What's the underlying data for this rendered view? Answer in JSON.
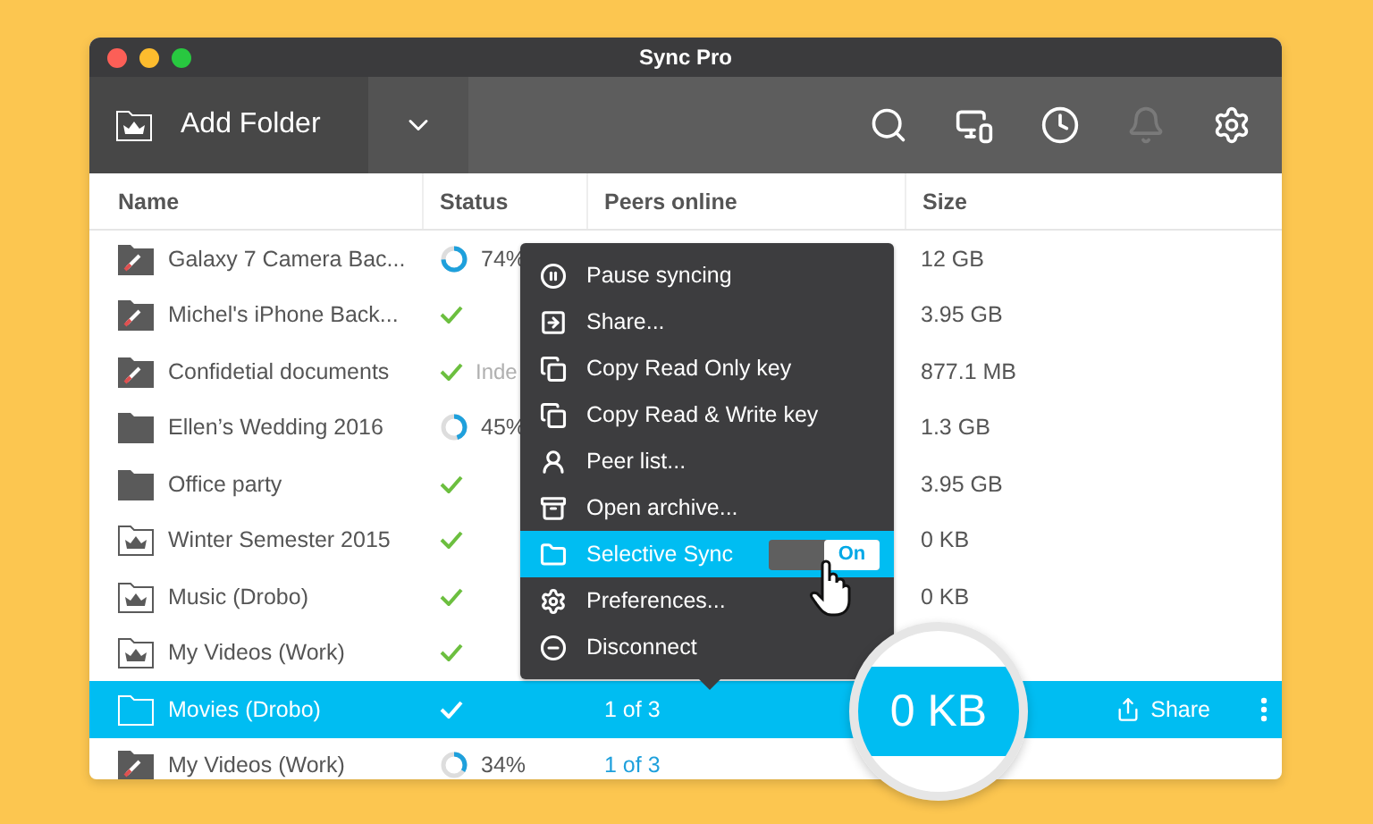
{
  "window": {
    "title": "Sync Pro"
  },
  "toolbar": {
    "add_label": "Add Folder",
    "bell_disabled": true
  },
  "table": {
    "columns": [
      "Name",
      "Status",
      "Peers online",
      "Size"
    ],
    "rows": [
      {
        "kind": "disconnected",
        "name": "Galaxy 7 Camera Bac...",
        "status": {
          "kind": "progress",
          "level": 0.74,
          "text": "74%"
        },
        "size": "12 GB",
        "selected": false
      },
      {
        "kind": "disconnected",
        "name": "Michel's iPhone Back...",
        "status": {
          "kind": "done"
        },
        "size": "3.95 GB",
        "selected": false
      },
      {
        "kind": "disconnected",
        "name": "Confidetial documents",
        "status": {
          "kind": "done",
          "text": "Inde"
        },
        "size": "877.1 MB",
        "selected": false
      },
      {
        "kind": "folder",
        "name": "Ellen’s Wedding 2016",
        "status": {
          "kind": "progress",
          "level": 0.45,
          "text": "45%"
        },
        "size": "1.3 GB",
        "selected": false
      },
      {
        "kind": "folder",
        "name": "Office party",
        "status": {
          "kind": "done"
        },
        "size": "3.95 GB",
        "selected": false
      },
      {
        "kind": "crown",
        "name": "Winter Semester 2015",
        "status": {
          "kind": "done"
        },
        "size": "0 KB",
        "selected": false
      },
      {
        "kind": "crown",
        "name": "Music (Drobo)",
        "status": {
          "kind": "done"
        },
        "size": "0 KB",
        "selected": false
      },
      {
        "kind": "crown",
        "name": "My Videos (Work)",
        "status": {
          "kind": "done"
        },
        "selected": false
      },
      {
        "kind": "plain",
        "name": "Movies (Drobo)",
        "status": {
          "kind": "done"
        },
        "peers": "1 of 3",
        "share": "Share",
        "selected": true
      },
      {
        "kind": "disconnected",
        "name": "My Videos (Work)",
        "status": {
          "kind": "progress",
          "level": 0.34,
          "text": "34%"
        },
        "peers": "1 of 3",
        "selected": false
      }
    ]
  },
  "context_menu": {
    "items": [
      {
        "kind": "pause",
        "label": "Pause syncing",
        "selected": false
      },
      {
        "kind": "share",
        "label": "Share...",
        "selected": false
      },
      {
        "kind": "copy",
        "label": "Copy Read Only key",
        "selected": false
      },
      {
        "kind": "copy",
        "label": "Copy Read & Write key",
        "selected": false
      },
      {
        "kind": "peer",
        "label": "Peer list...",
        "selected": false
      },
      {
        "kind": "archive",
        "label": "Open archive...",
        "selected": false
      },
      {
        "kind": "folder",
        "label": "Selective Sync",
        "selected": true,
        "toggle": {
          "on": true,
          "label": "On"
        }
      },
      {
        "kind": "gear",
        "label": "Preferences...",
        "selected": false
      },
      {
        "kind": "minus",
        "label": "Disconnect",
        "selected": false
      }
    ]
  },
  "magnifier": {
    "text": "0 KB"
  }
}
